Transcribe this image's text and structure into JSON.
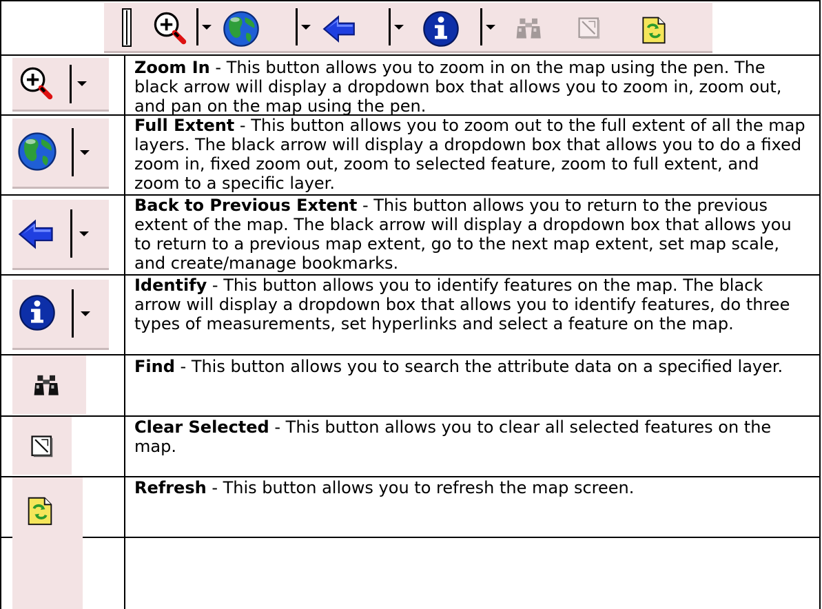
{
  "toolbar": {
    "icons": [
      "handle-icon",
      "zoom-in-icon",
      "full-extent-globe-icon",
      "back-arrow-icon",
      "identify-icon",
      "find-binoculars-icon",
      "clear-selected-icon",
      "refresh-icon"
    ]
  },
  "rows": [
    {
      "icon": "zoom-in-icon",
      "title": "Zoom In",
      "separator": " - ",
      "body": "This button allows you to zoom in on the map using the pen. The black arrow will display a dropdown box that allows you to zoom in, zoom out, and pan on the map using the pen."
    },
    {
      "icon": "full-extent-globe-icon",
      "title": "Full Extent",
      "separator": " - ",
      "body": "This button allows you to zoom out to the full extent of all the map layers.  The black arrow will display a dropdown box that allows you to do a fixed zoom in, fixed zoom out, zoom to selected feature, zoom to full extent, and zoom to a specific layer."
    },
    {
      "icon": "back-arrow-icon",
      "title": "Back to Previous Extent",
      "separator": " - ",
      "body": "This button allows you to return to the previous extent of the map.  The black arrow will display a dropdown box that allows you to return to a previous map extent, go to the next map extent, set map scale, and create/manage bookmarks."
    },
    {
      "icon": "identify-icon",
      "title": "Identify",
      "separator": " - ",
      "body": "This button allows you to identify features on the map.  The black arrow will display a dropdown box that allows you to identify features, do three types of measurements, set hyperlinks and select a feature on the map."
    },
    {
      "icon": "find-binoculars-icon",
      "title": "Find",
      "separator": " - ",
      "body": "This button allows you to search the attribute data on a specified layer."
    },
    {
      "icon": "clear-selected-icon",
      "title": "Clear Selected",
      "separator": " - ",
      "body": "This button allows you to clear all selected features on the map."
    },
    {
      "icon": "refresh-icon",
      "title": "Refresh",
      "separator": " - ",
      "body": "This button allows you to refresh the map screen."
    }
  ],
  "colors": {
    "tile_background": "#f3e3e4",
    "tile_shadow": "#c9b9ba",
    "grid_lines": "#000000",
    "globe_blue": "#1f5fd6",
    "globe_green": "#2e9e3a",
    "arrow_blue": "#1f3fe0",
    "identify_blue": "#0d2fa8",
    "disabled_grey": "#b8b8b8",
    "refresh_yellow": "#f5e55a"
  }
}
